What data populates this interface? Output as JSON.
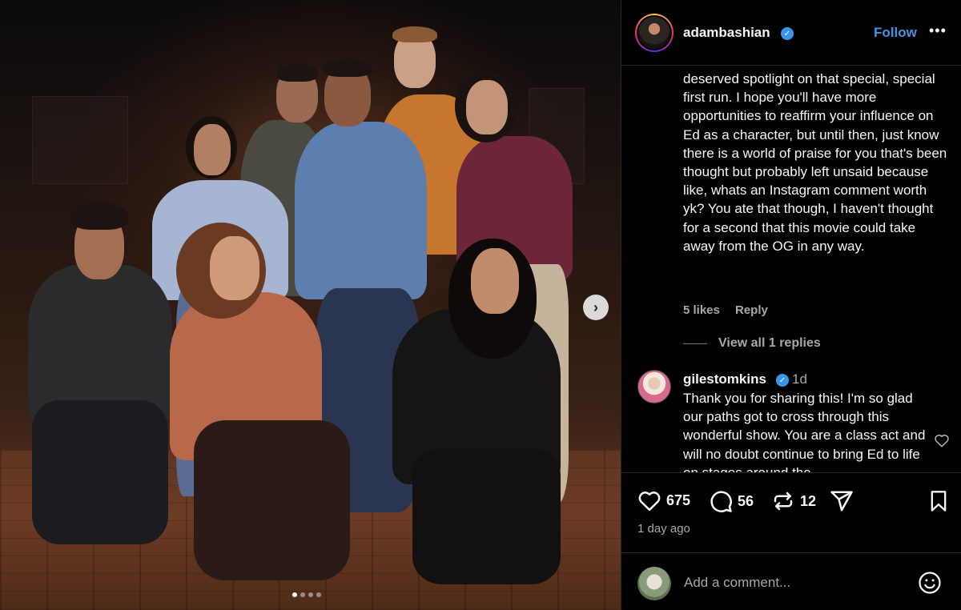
{
  "post": {
    "username": "adambashian",
    "follow_label": "Follow",
    "more_label": "•••"
  },
  "comments": {
    "first": {
      "text": "deserved spotlight on that special, special first run. I hope you'll have more opportunities to reaffirm your influence on Ed as a character, but until then, just know there is a world of praise for you that's been thought but probably left unsaid because like, whats an Instagram comment worth yk? You ate that though, I haven't thought for a second that this movie could take away from the OG in any way.",
      "likes": "5 likes",
      "reply_label": "Reply",
      "view_replies": "View all 1 replies"
    },
    "second": {
      "username": "gilestomkins",
      "time": "1d",
      "text": "Thank you for sharing this! I'm so glad our paths got to cross through this wonderful show. You are a class act and will no doubt continue to bring Ed to life on stages around the"
    }
  },
  "actions": {
    "likes_count": "675",
    "comments_count": "56",
    "reposts_count": "12",
    "date": "1 day ago"
  },
  "add_comment": {
    "placeholder": "Add a comment..."
  },
  "carousel": {
    "next_icon": "chevron-right-icon",
    "dots": 4,
    "active_dot": 1
  },
  "colors": {
    "accent": "#4a90e2",
    "verified": "#3797f0",
    "muted": "#a8a8a8"
  }
}
